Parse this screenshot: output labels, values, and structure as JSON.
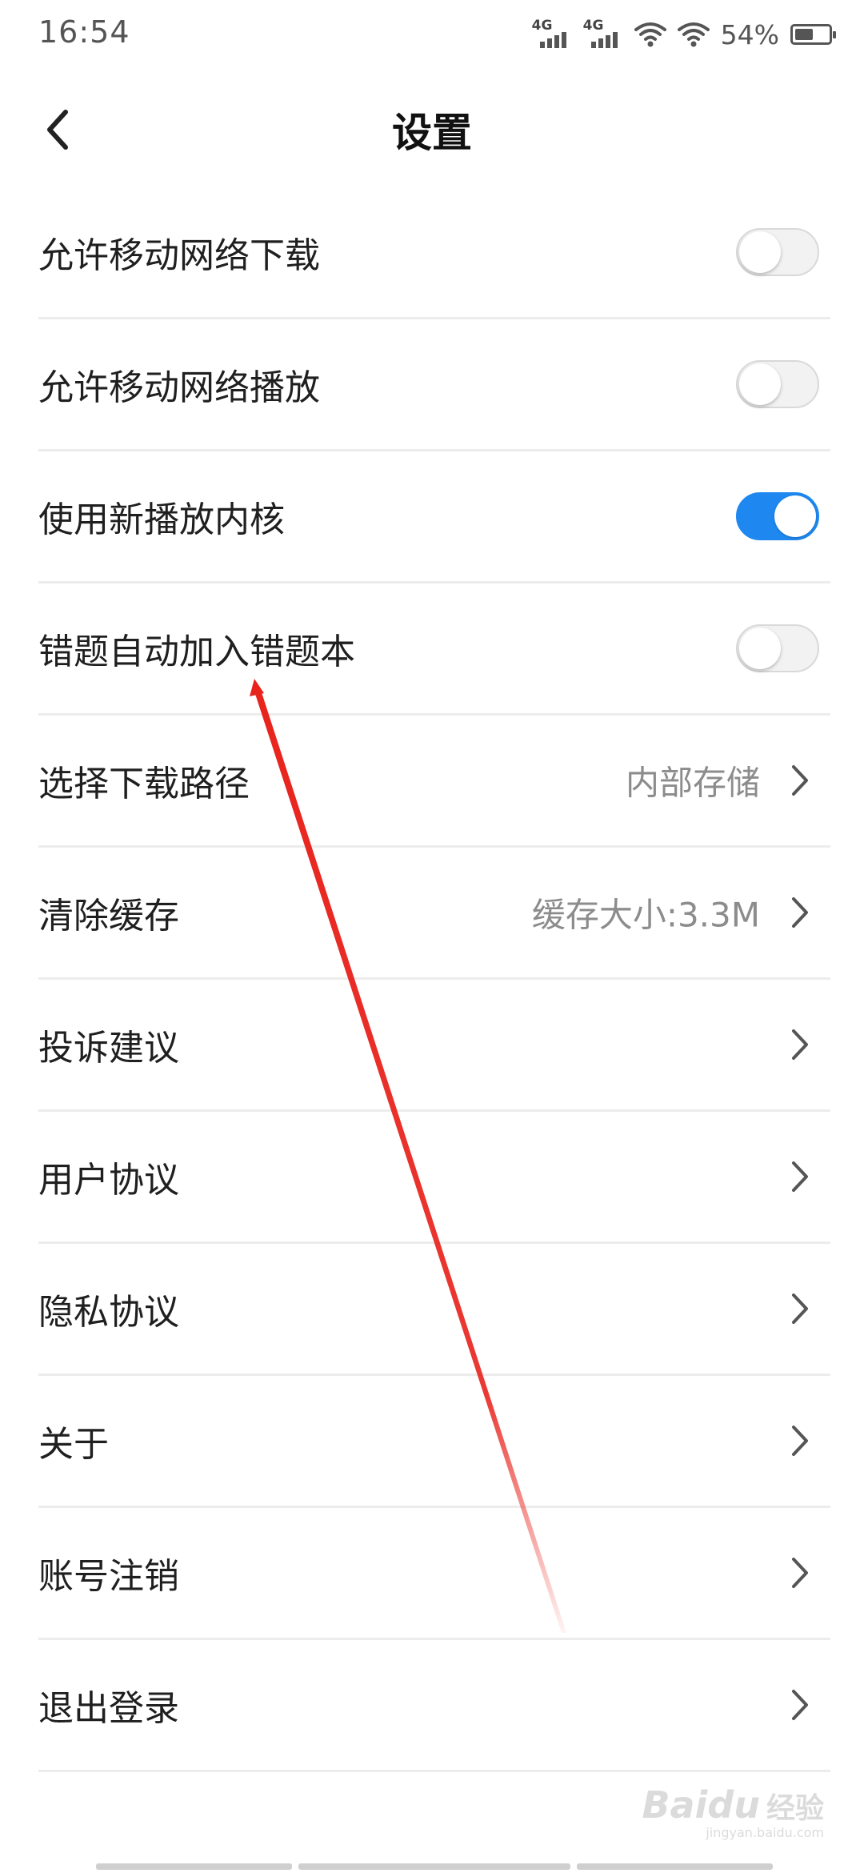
{
  "status_bar": {
    "time": "16:54",
    "network_1": "4G",
    "network_2": "4G",
    "battery_percent": "54%",
    "battery_level": 0.54,
    "icons": [
      "signal-icon",
      "signal-icon",
      "wifi-icon",
      "wifi-icon",
      "battery-icon"
    ]
  },
  "nav": {
    "title": "设置",
    "back_icon": "chevron-left-icon"
  },
  "toggle_rows": [
    {
      "label": "允许移动网络下载",
      "on": false
    },
    {
      "label": "允许移动网络播放",
      "on": false
    },
    {
      "label": "使用新播放内核",
      "on": true
    },
    {
      "label": "错题自动加入错题本",
      "on": false
    }
  ],
  "link_rows": [
    {
      "label": "选择下载路径",
      "value": "内部存储"
    },
    {
      "label": "清除缓存",
      "value": "缓存大小:3.3M"
    },
    {
      "label": "投诉建议",
      "value": ""
    },
    {
      "label": "用户协议",
      "value": ""
    },
    {
      "label": "隐私协议",
      "value": ""
    },
    {
      "label": "关于",
      "value": ""
    },
    {
      "label": "账号注销",
      "value": ""
    },
    {
      "label": "退出登录",
      "value": ""
    }
  ],
  "colors": {
    "accent": "#1e88f0",
    "annotation_arrow": "#e8231c",
    "divider": "#ececec",
    "secondary_text": "#8c8c8c"
  },
  "watermark": {
    "brand": "Baidu",
    "sub": "经验",
    "url": "jingyan.baidu.com"
  }
}
